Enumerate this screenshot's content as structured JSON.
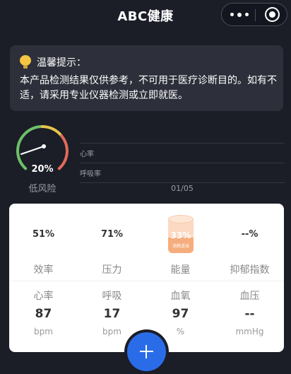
{
  "header": {
    "title": "ABC健康"
  },
  "tip": {
    "title": "温馨提示：",
    "body": "本产品检测结果仅供参考，不可用于医疗诊断目的。如有不适，请采用专业仪器检测或立即就医。"
  },
  "risk": {
    "value": "20%",
    "fraction": 0.2,
    "label": "低风险"
  },
  "chart": {
    "labels": [
      "心率",
      "呼吸率"
    ],
    "date": "01/05"
  },
  "metrics": [
    {
      "value": "51%",
      "label": "效率"
    },
    {
      "value": "71%",
      "label": "压力"
    },
    {
      "value": "33%",
      "sub": "消耗适当",
      "label": "能量",
      "fraction": 0.33
    },
    {
      "value": "--%",
      "label": "抑郁指数"
    }
  ],
  "vitals": [
    {
      "label": "心率",
      "value": "87",
      "unit": "bpm"
    },
    {
      "label": "呼吸",
      "value": "17",
      "unit": "bpm"
    },
    {
      "label": "血氧",
      "value": "97",
      "unit": "%"
    },
    {
      "label": "血压",
      "value": "--",
      "unit": "mmHg"
    }
  ],
  "colors": {
    "accent": "#2a6ce8",
    "gaugeGreen": "#6dc06a",
    "gaugeYellow": "#e8c54a",
    "gaugeRed": "#e06a5a"
  },
  "icons": {
    "tip": "lightbulb-icon",
    "fab": "plus-icon",
    "more": "more-dots-icon",
    "close": "target-close-icon"
  }
}
